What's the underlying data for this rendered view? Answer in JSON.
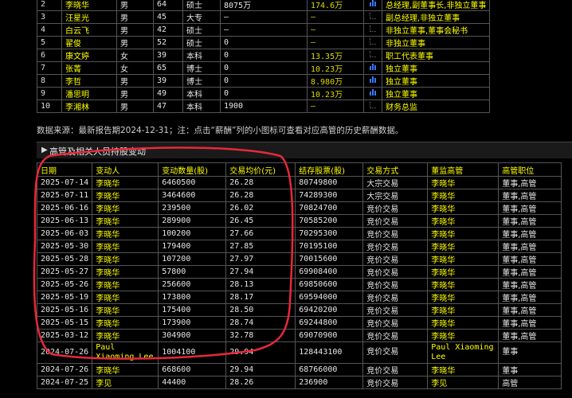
{
  "executives": [
    {
      "no": "2",
      "name": "李晓华",
      "sex": "男",
      "age": "64",
      "edu": "硕士",
      "hold": "8075万",
      "salary": "174.6万",
      "chart": true,
      "position": "总经理,副董事长,非独立董事"
    },
    {
      "no": "3",
      "name": "汪星光",
      "sex": "男",
      "age": "45",
      "edu": "大专",
      "hold": "—",
      "salary": "—",
      "chart": false,
      "position": "副总经理,非独立董事"
    },
    {
      "no": "4",
      "name": "白云飞",
      "sex": "男",
      "age": "42",
      "edu": "硕士",
      "hold": "—",
      "salary": "—",
      "chart": false,
      "position": "非独立董事,董事会秘书"
    },
    {
      "no": "5",
      "name": "翟俊",
      "sex": "男",
      "age": "52",
      "edu": "硕士",
      "hold": "0",
      "salary": "—",
      "chart": false,
      "position": "非独立董事"
    },
    {
      "no": "6",
      "name": "康文婷",
      "sex": "女",
      "age": "39",
      "edu": "本科",
      "hold": "0",
      "salary": "13.35万",
      "chart": false,
      "position": "职工代表董事"
    },
    {
      "no": "7",
      "name": "张菁",
      "sex": "女",
      "age": "65",
      "edu": "博士",
      "hold": "0",
      "salary": "10.23万",
      "chart": true,
      "position": "独立董事"
    },
    {
      "no": "8",
      "name": "李哲",
      "sex": "男",
      "age": "39",
      "edu": "博士",
      "hold": "0",
      "salary": "8.980万",
      "chart": true,
      "position": "独立董事"
    },
    {
      "no": "9",
      "name": "潘思明",
      "sex": "男",
      "age": "49",
      "edu": "本科",
      "hold": "0",
      "salary": "10.23万",
      "chart": true,
      "position": "独立董事"
    },
    {
      "no": "10",
      "name": "李湘林",
      "sex": "男",
      "age": "47",
      "edu": "本科",
      "hold": "1900",
      "salary": "—",
      "chart": false,
      "position": "财务总监"
    }
  ],
  "datasource_note": "数据来源：最新报告期2024-12-31；注：点击“薪酬”列的小图标可查看对应高管的历史薪酬数据。",
  "section_title": "高管及相关人员持股变动",
  "trade_headers": [
    "日期",
    "变动人",
    "变动数量(股)",
    "交易均价(元)",
    "结存股票(股)",
    "交易方式",
    "董监高管",
    "高管职位"
  ],
  "trades": [
    {
      "date": "2025-07-14",
      "person": "李晓华",
      "qty": "6460500",
      "price": "26.28",
      "held": "80749800",
      "method": "大宗交易",
      "exec": "李晓华",
      "role": "董事,高管"
    },
    {
      "date": "2025-07-11",
      "person": "李晓华",
      "qty": "3464600",
      "price": "26.28",
      "held": "74289300",
      "method": "大宗交易",
      "exec": "李晓华",
      "role": "董事,高管"
    },
    {
      "date": "2025-06-16",
      "person": "李晓华",
      "qty": "239500",
      "price": "26.02",
      "held": "70824700",
      "method": "竞价交易",
      "exec": "李晓华",
      "role": "董事,高管"
    },
    {
      "date": "2025-06-13",
      "person": "李晓华",
      "qty": "289900",
      "price": "26.45",
      "held": "70585200",
      "method": "竞价交易",
      "exec": "李晓华",
      "role": "董事,高管"
    },
    {
      "date": "2025-06-03",
      "person": "李晓华",
      "qty": "100200",
      "price": "27.66",
      "held": "70295300",
      "method": "竞价交易",
      "exec": "李晓华",
      "role": "董事,高管"
    },
    {
      "date": "2025-05-30",
      "person": "李晓华",
      "qty": "179400",
      "price": "27.85",
      "held": "70195100",
      "method": "竞价交易",
      "exec": "李晓华",
      "role": "董事,高管"
    },
    {
      "date": "2025-05-28",
      "person": "李晓华",
      "qty": "107200",
      "price": "27.97",
      "held": "70015600",
      "method": "竞价交易",
      "exec": "李晓华",
      "role": "董事,高管"
    },
    {
      "date": "2025-05-27",
      "person": "李晓华",
      "qty": "57800",
      "price": "27.94",
      "held": "69908400",
      "method": "竞价交易",
      "exec": "李晓华",
      "role": "董事,高管"
    },
    {
      "date": "2025-05-26",
      "person": "李晓华",
      "qty": "256600",
      "price": "28.13",
      "held": "69850600",
      "method": "竞价交易",
      "exec": "李晓华",
      "role": "董事,高管"
    },
    {
      "date": "2025-05-19",
      "person": "李晓华",
      "qty": "173800",
      "price": "28.17",
      "held": "69594000",
      "method": "竞价交易",
      "exec": "李晓华",
      "role": "董事,高管"
    },
    {
      "date": "2025-05-16",
      "person": "李晓华",
      "qty": "175400",
      "price": "28.50",
      "held": "69420200",
      "method": "竞价交易",
      "exec": "李晓华",
      "role": "董事,高管"
    },
    {
      "date": "2025-05-15",
      "person": "李晓华",
      "qty": "173900",
      "price": "28.74",
      "held": "69244800",
      "method": "竞价交易",
      "exec": "李晓华",
      "role": "董事,高管"
    },
    {
      "date": "2025-03-12",
      "person": "李晓华",
      "qty": "304900",
      "price": "32.78",
      "held": "69070900",
      "method": "竞价交易",
      "exec": "李晓华",
      "role": "董事,高管"
    },
    {
      "date": "2024-07-26",
      "person": "Paul Xiaoming Lee",
      "qty": "1004100",
      "price": "29.94",
      "held": "128443100",
      "method": "竞价交易",
      "exec": "Paul Xiaoming Lee",
      "role": "董事"
    },
    {
      "date": "2024-07-26",
      "person": "李晓华",
      "qty": "668600",
      "price": "29.94",
      "held": "68766000",
      "method": "竞价交易",
      "exec": "李晓华",
      "role": "董事"
    },
    {
      "date": "2024-07-25",
      "person": "李见",
      "qty": "44400",
      "price": "28.26",
      "held": "236900",
      "method": "竞价交易",
      "exec": "李见",
      "role": "高管"
    }
  ],
  "colors": {
    "background": "#000000",
    "text": "#e6e6e6",
    "highlight": "#ffff00",
    "grid": "#555555",
    "annotation": "#e8283c",
    "chart_icon": "#3a78ff"
  },
  "icons": {
    "salary_chart": "bar-chart-icon",
    "section_toggle": "triangle-right-icon"
  }
}
